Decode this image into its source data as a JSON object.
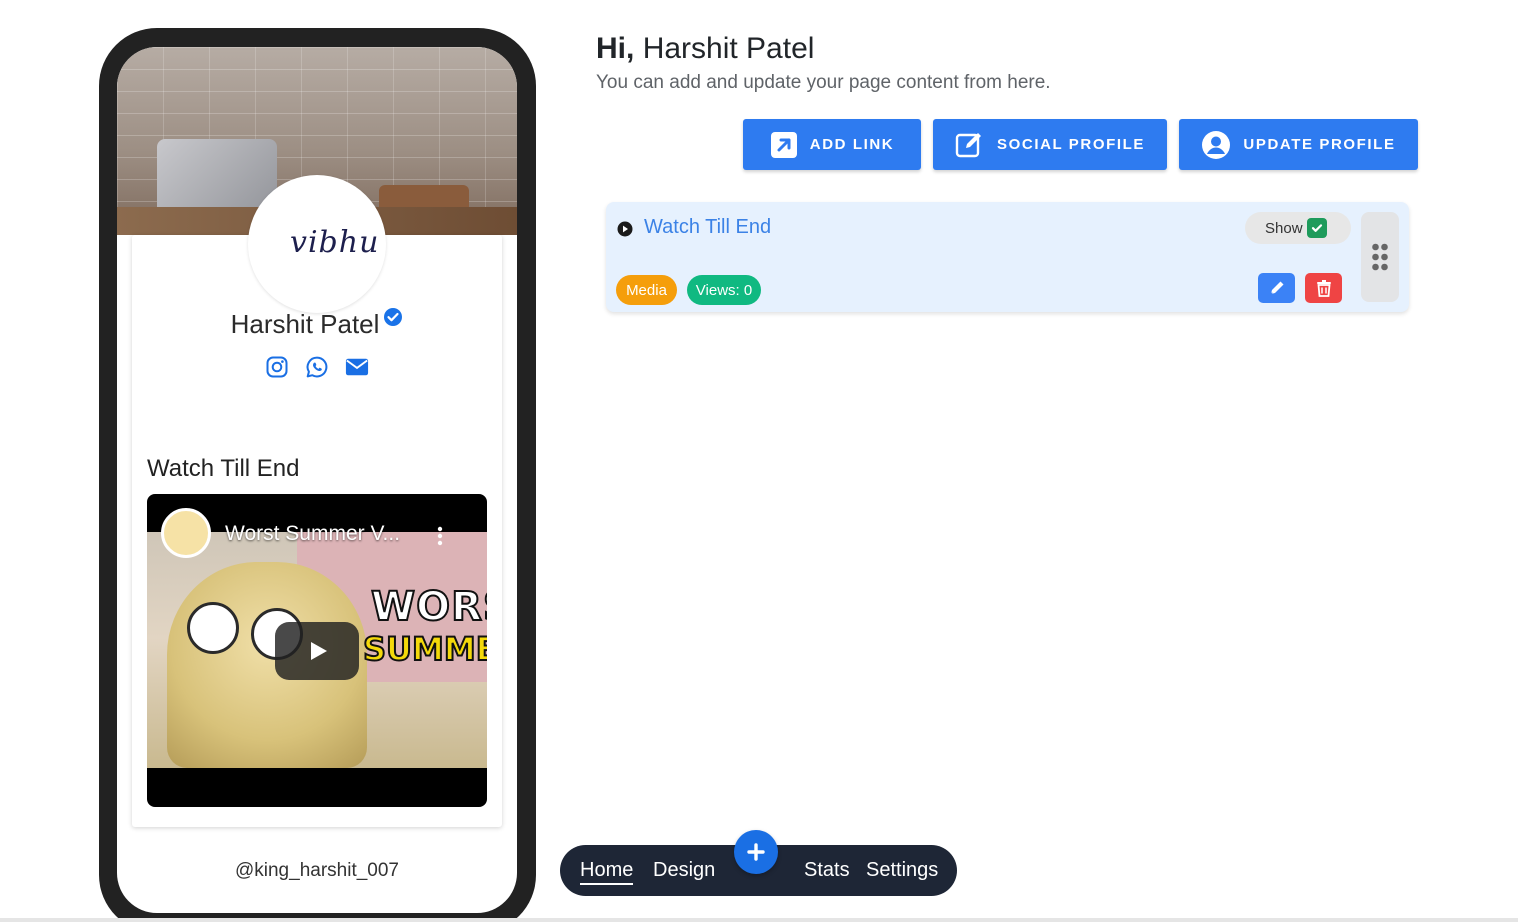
{
  "preview": {
    "avatar_signature": "vibhu",
    "name": "Harshit Patel",
    "social_icons": [
      "instagram-icon",
      "whatsapp-icon",
      "envelope-icon"
    ],
    "block_title": "Watch Till End",
    "video": {
      "title": "Worst Summer V...",
      "thumbnail_text_1": "WORST",
      "thumbnail_text_2": "SUMMER"
    },
    "handle": "@king_harshit_007"
  },
  "header": {
    "greeting_prefix": "Hi,",
    "greeting_name": "Harshit Patel",
    "subtitle": "You can add and update your page content from here."
  },
  "actions": {
    "add_link": "ADD LINK",
    "social_profile": "SOCIAL PROFILE",
    "update_profile": "UPDATE PROFILE"
  },
  "links": [
    {
      "title": "Watch Till End",
      "visibility_label": "Show",
      "type_badge": "Media",
      "views_badge": "Views: 0"
    }
  ],
  "nav": {
    "home": "Home",
    "design": "Design",
    "stats": "Stats",
    "settings": "Settings"
  },
  "colors": {
    "primary": "#2e7bf0",
    "media_badge": "#f59e0b",
    "views_badge": "#10b981",
    "edit_button": "#3b82f6",
    "delete_button": "#ef4444",
    "nav_bg": "#1e2636"
  }
}
